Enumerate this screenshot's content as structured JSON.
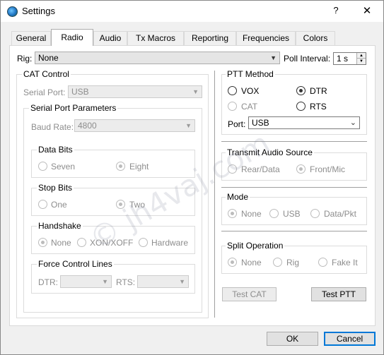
{
  "window": {
    "title": "Settings",
    "help_glyph": "?",
    "close_glyph": "✕"
  },
  "tabs": [
    "General",
    "Radio",
    "Audio",
    "Tx Macros",
    "Reporting",
    "Frequencies",
    "Colors"
  ],
  "rig": {
    "label": "Rig:",
    "value": "None",
    "poll_label": "Poll Interval:",
    "poll_value": "1 s"
  },
  "cat": {
    "title": "CAT Control",
    "serial_port_label": "Serial Port:",
    "serial_port_value": "USB",
    "params_title": "Serial Port Parameters",
    "baud_label": "Baud Rate:",
    "baud_value": "4800",
    "data_bits": {
      "title": "Data Bits",
      "options": [
        "Seven",
        "Eight"
      ],
      "selected": "Eight"
    },
    "stop_bits": {
      "title": "Stop Bits",
      "options": [
        "One",
        "Two"
      ],
      "selected": "Two"
    },
    "handshake": {
      "title": "Handshake",
      "options": [
        "None",
        "XON/XOFF",
        "Hardware"
      ],
      "selected": "None"
    },
    "force": {
      "title": "Force Control Lines",
      "dtr_label": "DTR:",
      "rts_label": "RTS:"
    }
  },
  "ptt": {
    "title": "PTT Method",
    "options": [
      "VOX",
      "DTR",
      "CAT",
      "RTS"
    ],
    "selected": "DTR",
    "port_label": "Port:",
    "port_value": "USB"
  },
  "audio_source": {
    "title": "Transmit Audio Source",
    "options": [
      "Rear/Data",
      "Front/Mic"
    ],
    "selected": "Front/Mic"
  },
  "mode": {
    "title": "Mode",
    "options": [
      "None",
      "USB",
      "Data/Pkt"
    ],
    "selected": "None"
  },
  "split": {
    "title": "Split Operation",
    "options": [
      "None",
      "Rig",
      "Fake It"
    ],
    "selected": "None"
  },
  "buttons": {
    "test_cat": "Test CAT",
    "test_ptt": "Test PTT",
    "ok": "OK",
    "cancel": "Cancel"
  },
  "watermark": "© jh4vaj.com"
}
